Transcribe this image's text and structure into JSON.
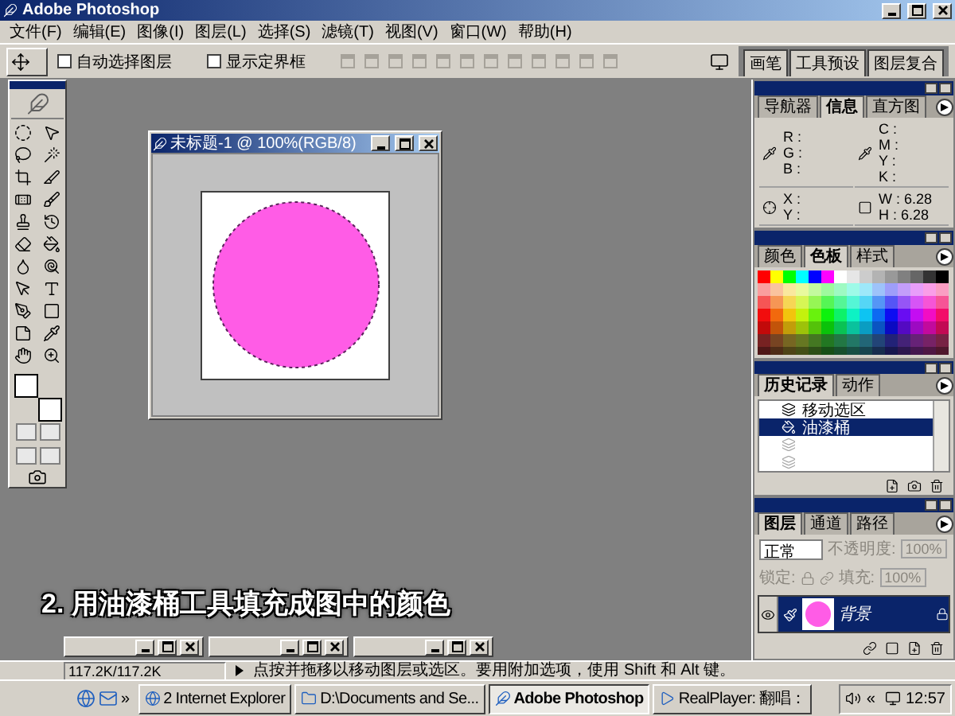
{
  "app_window": {
    "title": "Adobe Photoshop"
  },
  "menu": [
    "文件(F)",
    "编辑(E)",
    "图像(I)",
    "图层(L)",
    "选择(S)",
    "滤镜(T)",
    "视图(V)",
    "窗口(W)",
    "帮助(H)"
  ],
  "options_bar": {
    "checkboxes": [
      {
        "label": "自动选择图层",
        "checked": false
      },
      {
        "label": "显示定界框",
        "checked": false
      }
    ],
    "palette_well": [
      "画笔",
      "工具预设",
      "图层复合"
    ]
  },
  "document": {
    "title": "未标题-1 @ 100%(RGB/8)"
  },
  "caption": "2. 用油漆桶工具填充成图中的颜色",
  "minimized_windows": [
    {
      "kind": "window"
    },
    {
      "kind": "window"
    },
    {
      "kind": "window"
    }
  ],
  "panels": {
    "info": {
      "tabs": [
        {
          "label": "导航器",
          "selected": false
        },
        {
          "label": "信息",
          "selected": true
        },
        {
          "label": "直方图",
          "selected": false
        }
      ],
      "rgb": [
        "R :",
        "G :",
        "B :"
      ],
      "cmyk": [
        "C :",
        "M :",
        "Y :",
        "K :"
      ],
      "xy": [
        "X :",
        "Y :"
      ],
      "size": [
        {
          "label": "W :",
          "value": "6.28"
        },
        {
          "label": "H :",
          "value": "6.28"
        }
      ]
    },
    "color": {
      "tabs": [
        {
          "label": "颜色",
          "selected": false
        },
        {
          "label": "色板",
          "selected": true
        },
        {
          "label": "样式",
          "selected": false
        }
      ]
    },
    "history": {
      "tabs": [
        {
          "label": "历史记录",
          "selected": true
        },
        {
          "label": "动作",
          "selected": false
        }
      ],
      "steps": [
        {
          "label": "移动选区",
          "selected": false,
          "disabled": false
        },
        {
          "label": "油漆桶",
          "selected": true,
          "disabled": false
        },
        {
          "selected": false,
          "disabled": true
        },
        {
          "selected": false,
          "disabled": true
        }
      ]
    },
    "layers": {
      "tabs": [
        {
          "label": "图层",
          "selected": true
        },
        {
          "label": "通道",
          "selected": false
        },
        {
          "label": "路径",
          "selected": false
        }
      ],
      "blend_mode": "正常",
      "opacity_label": "不透明度:",
      "opacity": "100%",
      "lock_label": "锁定:",
      "fill_label": "填充:",
      "fill": "100%",
      "layers": [
        {
          "name": "背景",
          "selected": true,
          "visible": true
        }
      ]
    }
  },
  "status_bar": {
    "doc_size": "117.2K/117.2K",
    "hint": "点按并拖移以移动图层或选区。要用附加选项，使用 Shift 和 Alt 键。"
  },
  "taskbar": {
    "more": "»",
    "tasks": [
      {
        "label": "2 Internet Explorer",
        "selected": false,
        "kind": "browser"
      },
      {
        "label": "D:\\Documents and Se...",
        "selected": false,
        "kind": "folder"
      },
      {
        "label": "Adobe Photoshop",
        "selected": true,
        "kind": "app"
      },
      {
        "label": "RealPlayer: 翻唱：",
        "selected": false,
        "kind": "player"
      }
    ],
    "tray_more": "«",
    "clock": "12:57"
  }
}
